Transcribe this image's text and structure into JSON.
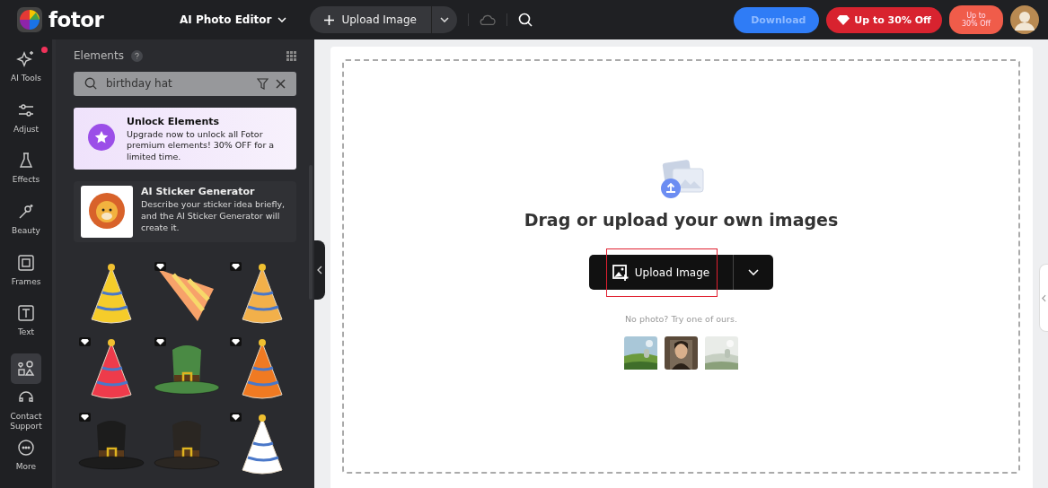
{
  "header": {
    "logo": "fotor",
    "editor_menu": "AI Photo Editor",
    "upload": "Upload Image",
    "download": "Download",
    "offer": "Up to 30% Off",
    "offer_small": "Up to\n30% Off"
  },
  "rail": [
    {
      "label": "AI Tools",
      "selected": false,
      "dot": true
    },
    {
      "label": "Adjust",
      "selected": false,
      "dot": false
    },
    {
      "label": "Effects",
      "selected": false,
      "dot": false
    },
    {
      "label": "Beauty",
      "selected": false,
      "dot": false
    },
    {
      "label": "Frames",
      "selected": false,
      "dot": false
    },
    {
      "label": "Text",
      "selected": false,
      "dot": false
    },
    {
      "selected": true,
      "dot": false
    },
    {
      "label": "Contact Support",
      "selected": false,
      "dot": false
    },
    {
      "label": "More",
      "selected": false,
      "dot": false
    }
  ],
  "panel": {
    "title": "Elements",
    "search": {
      "value": "birthday hat"
    },
    "promo": {
      "title": "Unlock Elements",
      "text": "Upgrade now to unlock all Fotor premium elements! 30% OFF for a limited time."
    },
    "generator": {
      "title": "AI Sticker Generator",
      "text": "Describe your sticker idea briefly, and the AI Sticker Generator will create it."
    },
    "stickers": [
      {
        "kind": "cone",
        "color": "#f5cc2a",
        "premium": false
      },
      {
        "kind": "slice",
        "color": "#f7a26a",
        "premium": true
      },
      {
        "kind": "cone",
        "color": "#f2b04a",
        "premium": true
      },
      {
        "kind": "cone",
        "color": "#ee3b4b",
        "premium": true
      },
      {
        "kind": "top-hat",
        "color": "#4a8a44",
        "premium": true
      },
      {
        "kind": "cone",
        "color": "#f07a22",
        "premium": true
      },
      {
        "kind": "top-hat",
        "color": "#1c1c1c",
        "premium": true
      },
      {
        "kind": "top-hat",
        "color": "#2a2622",
        "premium": false
      },
      {
        "kind": "cone",
        "color": "#ffffff",
        "premium": true
      }
    ]
  },
  "canvas": {
    "heading": "Drag or upload your own images",
    "upload": "Upload Image",
    "hint": "No photo? Try one of ours."
  }
}
